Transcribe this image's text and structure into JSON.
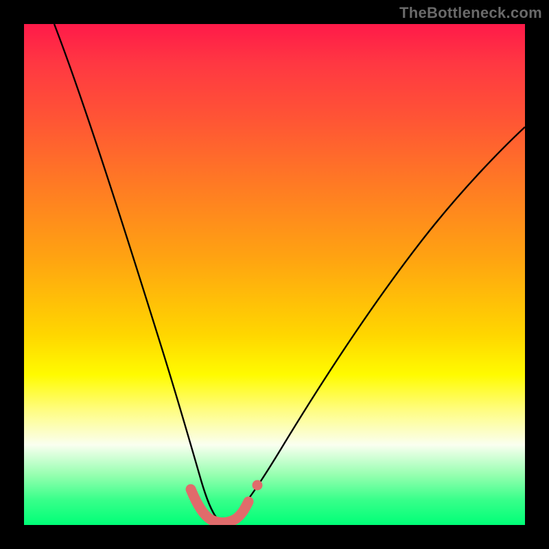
{
  "watermark": "TheBottleneck.com",
  "chart_data": {
    "type": "line",
    "title": "",
    "xlabel": "",
    "ylabel": "",
    "xlim": [
      0,
      100
    ],
    "ylim": [
      0,
      100
    ],
    "notes": "No axis ticks or numeric labels are rendered in the image; values are estimated from pixel positions. The curve is a V-shaped dip reaching ~0 around x≈38, rising on both sides. Background gradient runs from red (top, high y) to green (bottom, low y).",
    "series": [
      {
        "name": "bottleneck-curve",
        "color": "#000000",
        "x": [
          6,
          10,
          15,
          20,
          25,
          28,
          31,
          33,
          35,
          37,
          39,
          41,
          43,
          46,
          50,
          55,
          60,
          65,
          70,
          75,
          80,
          85,
          90,
          95,
          100
        ],
        "y": [
          100,
          88,
          73,
          59,
          43,
          33,
          22,
          12,
          4,
          1,
          0,
          0,
          1,
          4,
          10,
          18,
          27,
          34,
          42,
          49,
          56,
          62,
          68,
          73,
          78
        ]
      },
      {
        "name": "highlight-bottom",
        "color": "#e06b6b",
        "x": [
          33.2,
          34.0,
          35.0,
          36.0,
          37.0,
          38.0,
          39.0,
          40.0,
          41.0,
          42.0,
          43.0,
          44.2,
          45.6
        ],
        "y": [
          7.0,
          5.0,
          3.3,
          2.0,
          1.1,
          0.6,
          0.5,
          0.6,
          1.0,
          1.8,
          3.0,
          5.0,
          8.0
        ],
        "style": "thick-rounded-with-dots"
      }
    ]
  }
}
